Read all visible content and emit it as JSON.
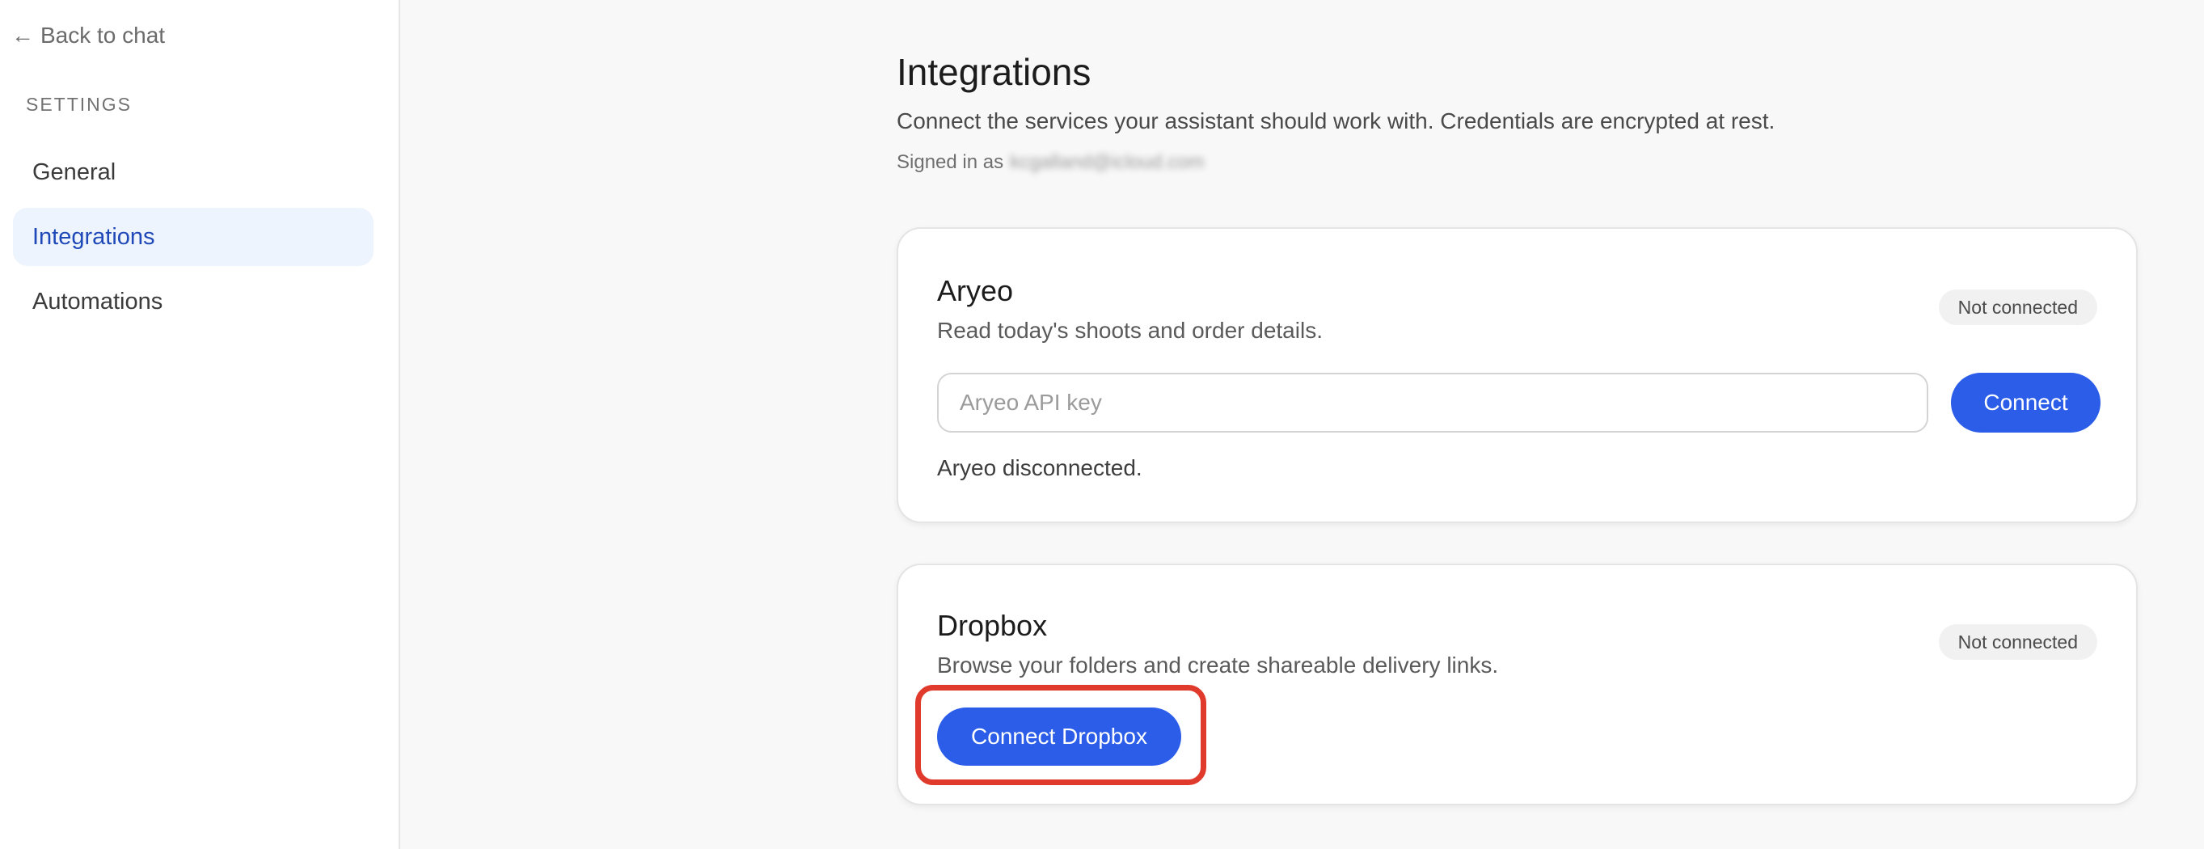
{
  "sidebar": {
    "back_label": "Back to chat",
    "back_arrow": "←",
    "section_heading": "SETTINGS",
    "items": [
      {
        "label": "General",
        "active": false
      },
      {
        "label": "Integrations",
        "active": true
      },
      {
        "label": "Automations",
        "active": false
      }
    ]
  },
  "main": {
    "title": "Integrations",
    "subtitle": "Connect the services your assistant should work with. Credentials are encrypted at rest.",
    "signed_in_label": "Signed in as",
    "signed_in_email": "kcgalland@icloud.com"
  },
  "integrations": [
    {
      "name": "Aryeo",
      "description": "Read today's shoots and order details.",
      "status": "Not connected",
      "input_placeholder": "Aryeo API key",
      "input_value": "",
      "button_label": "Connect",
      "message": "Aryeo disconnected."
    },
    {
      "name": "Dropbox",
      "description": "Browse your folders and create shareable delivery links.",
      "status": "Not connected",
      "button_label": "Connect Dropbox"
    }
  ],
  "colors": {
    "accent": "#2b5de8",
    "active_nav_bg": "#eef4fd",
    "active_nav_text": "#1f48b8",
    "highlight": "#e03a2c"
  }
}
